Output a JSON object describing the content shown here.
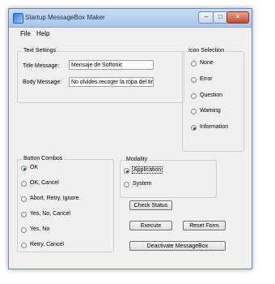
{
  "window": {
    "title": "Startup MessageBox Maker"
  },
  "menu": [
    "File",
    "Help"
  ],
  "text_settings": {
    "legend": "Text Settings",
    "title_label": "Title Message:",
    "title_value": "Mensaje de Softonic",
    "body_label": "Body Message:",
    "body_value": "No olvides recoger la ropa del tinte"
  },
  "icon_selection": {
    "legend": "Icon Selection",
    "options": [
      "None",
      "Error",
      "Question",
      "Warning",
      "Information"
    ],
    "selected": "Information"
  },
  "button_combos": {
    "legend": "Button Combos",
    "options": [
      "OK",
      "OK, Cancel",
      "Abort, Retry, Ignore",
      "Yes, No, Cancel",
      "Yes, No",
      "Retry, Cancel"
    ],
    "selected": "OK"
  },
  "modality": {
    "legend": "Modality",
    "options": [
      "Application",
      "System"
    ],
    "selected": "Application"
  },
  "buttons": {
    "check_status": "Check Status",
    "execute": "Execute",
    "reset": "Reset Form",
    "deactivate": "Deactivate MessageBox"
  }
}
